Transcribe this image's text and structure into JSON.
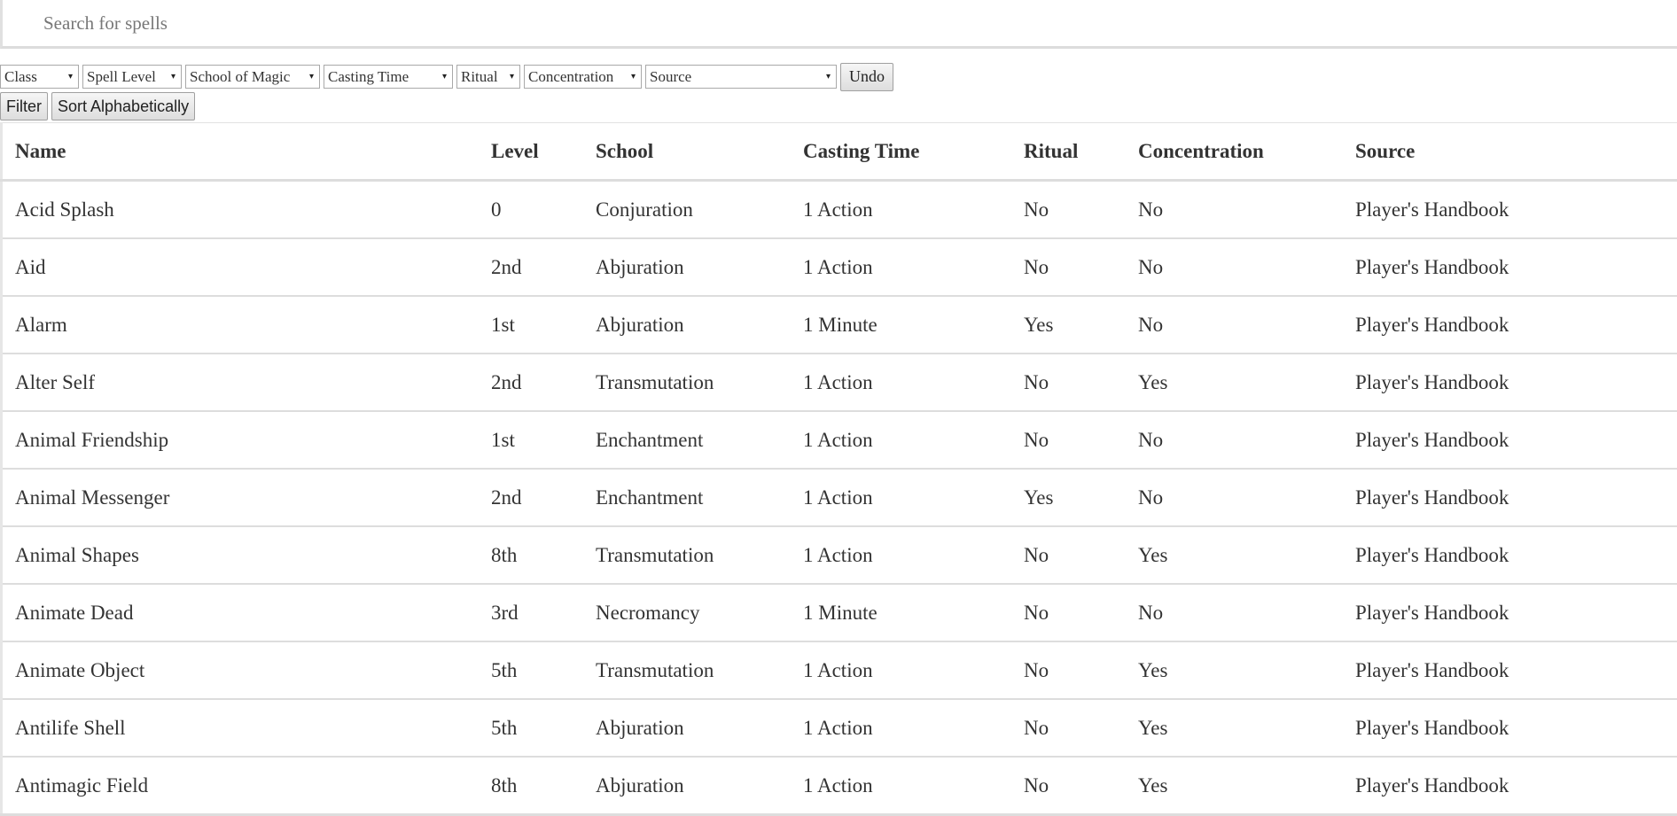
{
  "search": {
    "placeholder": "Search for spells",
    "value": ""
  },
  "filters": {
    "selects": [
      {
        "name": "class",
        "label": "Class"
      },
      {
        "name": "spell-level",
        "label": "Spell Level"
      },
      {
        "name": "school",
        "label": "School of Magic"
      },
      {
        "name": "casting-time",
        "label": "Casting Time"
      },
      {
        "name": "ritual",
        "label": "Ritual"
      },
      {
        "name": "concentration",
        "label": "Concentration"
      },
      {
        "name": "source",
        "label": "Source"
      }
    ],
    "undo_label": "Undo",
    "filter_label": "Filter",
    "sort_label": "Sort Alphabetically",
    "arrow_glyph": "▾"
  },
  "table": {
    "headers": [
      "Name",
      "Level",
      "School",
      "Casting Time",
      "Ritual",
      "Concentration",
      "Source"
    ],
    "rows": [
      [
        "Acid Splash",
        "0",
        "Conjuration",
        "1 Action",
        "No",
        "No",
        "Player's Handbook"
      ],
      [
        "Aid",
        "2nd",
        "Abjuration",
        "1 Action",
        "No",
        "No",
        "Player's Handbook"
      ],
      [
        "Alarm",
        "1st",
        "Abjuration",
        "1 Minute",
        "Yes",
        "No",
        "Player's Handbook"
      ],
      [
        "Alter Self",
        "2nd",
        "Transmutation",
        "1 Action",
        "No",
        "Yes",
        "Player's Handbook"
      ],
      [
        "Animal Friendship",
        "1st",
        "Enchantment",
        "1 Action",
        "No",
        "No",
        "Player's Handbook"
      ],
      [
        "Animal Messenger",
        "2nd",
        "Enchantment",
        "1 Action",
        "Yes",
        "No",
        "Player's Handbook"
      ],
      [
        "Animal Shapes",
        "8th",
        "Transmutation",
        "1 Action",
        "No",
        "Yes",
        "Player's Handbook"
      ],
      [
        "Animate Dead",
        "3rd",
        "Necromancy",
        "1 Minute",
        "No",
        "No",
        "Player's Handbook"
      ],
      [
        "Animate Object",
        "5th",
        "Transmutation",
        "1 Action",
        "No",
        "Yes",
        "Player's Handbook"
      ],
      [
        "Antilife Shell",
        "5th",
        "Abjuration",
        "1 Action",
        "No",
        "Yes",
        "Player's Handbook"
      ],
      [
        "Antimagic Field",
        "8th",
        "Abjuration",
        "1 Action",
        "No",
        "Yes",
        "Player's Handbook"
      ]
    ]
  }
}
